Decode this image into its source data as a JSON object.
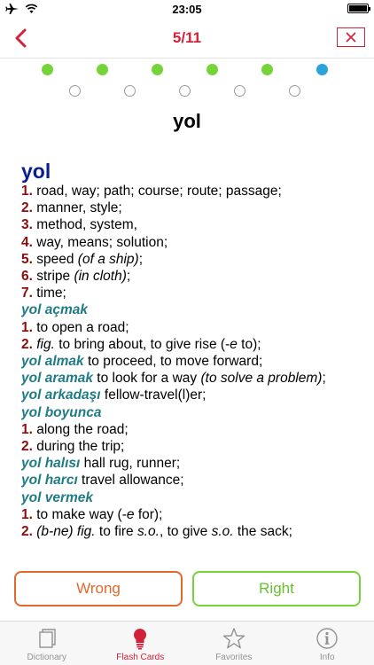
{
  "status_bar": {
    "time": "23:05"
  },
  "nav": {
    "title": "5/11"
  },
  "progress": {
    "total": 11,
    "completed": 5,
    "current": 6
  },
  "headword": "yol",
  "entry": {
    "head": "yol",
    "lines": [
      [
        {
          "t": "num",
          "v": "1."
        },
        {
          "t": "txt",
          "v": " road, way; path; course; route; passage;"
        }
      ],
      [
        {
          "t": "num",
          "v": "2."
        },
        {
          "t": "txt",
          "v": " manner, style;"
        }
      ],
      [
        {
          "t": "num",
          "v": "3."
        },
        {
          "t": "txt",
          "v": " method, system,"
        }
      ],
      [
        {
          "t": "num",
          "v": "4."
        },
        {
          "t": "txt",
          "v": " way, means; solution;"
        }
      ],
      [
        {
          "t": "num",
          "v": "5."
        },
        {
          "t": "txt",
          "v": " speed "
        },
        {
          "t": "it",
          "v": "(of a ship)"
        },
        {
          "t": "txt",
          "v": ";"
        }
      ],
      [
        {
          "t": "num",
          "v": "6."
        },
        {
          "t": "txt",
          "v": " stripe "
        },
        {
          "t": "it",
          "v": "(in cloth)"
        },
        {
          "t": "txt",
          "v": ";"
        }
      ],
      [
        {
          "t": "num",
          "v": "7."
        },
        {
          "t": "txt",
          "v": " time;"
        }
      ],
      [
        {
          "t": "phrase",
          "v": "yol açmak"
        }
      ],
      [
        {
          "t": "num",
          "v": "1."
        },
        {
          "t": "txt",
          "v": " to open a road;"
        }
      ],
      [
        {
          "t": "num",
          "v": "2."
        },
        {
          "t": "txt",
          "v": " "
        },
        {
          "t": "it",
          "v": "fig."
        },
        {
          "t": "txt",
          "v": " to bring about, to give rise (-"
        },
        {
          "t": "it",
          "v": "e"
        },
        {
          "t": "txt",
          "v": " to);"
        }
      ],
      [
        {
          "t": "phrase",
          "v": "yol almak"
        },
        {
          "t": "txt",
          "v": " to proceed, to move forward;"
        }
      ],
      [
        {
          "t": "phrase",
          "v": "yol aramak"
        },
        {
          "t": "txt",
          "v": " to look for a way "
        },
        {
          "t": "it",
          "v": "(to solve a problem)"
        },
        {
          "t": "txt",
          "v": ";"
        }
      ],
      [
        {
          "t": "phrase",
          "v": "yol arkadaşı"
        },
        {
          "t": "txt",
          "v": " fellow-travel(l)er;"
        }
      ],
      [
        {
          "t": "phrase",
          "v": "yol boyunca"
        }
      ],
      [
        {
          "t": "num",
          "v": "1."
        },
        {
          "t": "txt",
          "v": " along the road;"
        }
      ],
      [
        {
          "t": "num",
          "v": "2."
        },
        {
          "t": "txt",
          "v": " during the trip;"
        }
      ],
      [
        {
          "t": "phrase",
          "v": "yol halısı"
        },
        {
          "t": "txt",
          "v": " hall rug, runner;"
        }
      ],
      [
        {
          "t": "phrase",
          "v": "yol harcı"
        },
        {
          "t": "txt",
          "v": " travel allowance;"
        }
      ],
      [
        {
          "t": "phrase",
          "v": "yol vermek"
        }
      ],
      [
        {
          "t": "num",
          "v": "1."
        },
        {
          "t": "txt",
          "v": " to make way (-"
        },
        {
          "t": "it",
          "v": "e"
        },
        {
          "t": "txt",
          "v": " for);"
        }
      ],
      [
        {
          "t": "num",
          "v": "2."
        },
        {
          "t": "txt",
          "v": " "
        },
        {
          "t": "it",
          "v": "(b-ne) fig."
        },
        {
          "t": "txt",
          "v": " to fire "
        },
        {
          "t": "it",
          "v": "s.o."
        },
        {
          "t": "txt",
          "v": ", to give "
        },
        {
          "t": "it",
          "v": "s.o."
        },
        {
          "t": "txt",
          "v": " the sack;"
        }
      ]
    ]
  },
  "buttons": {
    "wrong": "Wrong",
    "right": "Right"
  },
  "tabs": [
    {
      "label": "Dictionary",
      "icon": "dictionary-icon",
      "active": false
    },
    {
      "label": "Flash Cards",
      "icon": "lightbulb-icon",
      "active": true
    },
    {
      "label": "Favorites",
      "icon": "star-icon",
      "active": false
    },
    {
      "label": "Info",
      "icon": "info-icon",
      "active": false
    }
  ],
  "colors": {
    "accent": "#d3213a",
    "done_dot": "#76d43b",
    "current_dot": "#2aa3dc",
    "entry_head": "#0a1f8f",
    "sense_number": "#8b0d0d",
    "phrase": "#1f7b86",
    "wrong": "#e2682c",
    "right": "#76d43b"
  }
}
